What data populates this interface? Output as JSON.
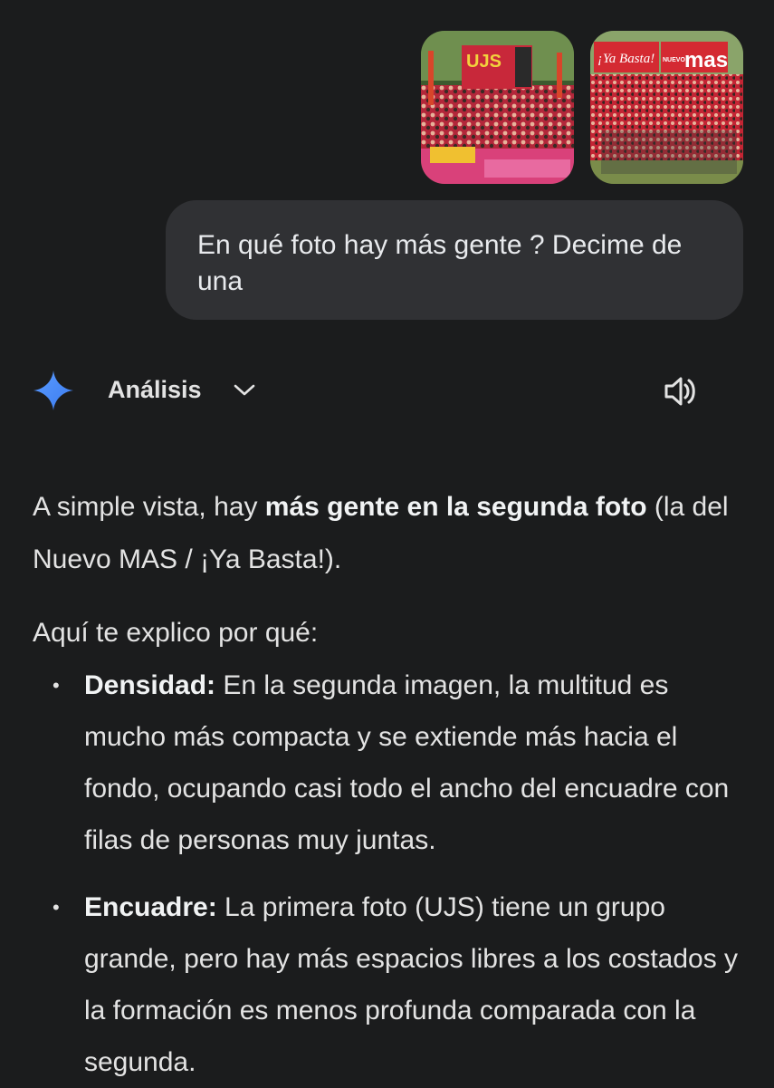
{
  "attachments": [
    {
      "banner_text": "UJS"
    },
    {
      "banner_text": "¡Ya Basta!",
      "banner_text_2": "NUEVO",
      "banner_text_3": "mas"
    }
  ],
  "user_message": {
    "text": "En qué foto hay más gente ? Decime de una"
  },
  "response": {
    "mode_label": "Análisis",
    "icons": {
      "logo": "gemini-sparkle-icon",
      "mode": "chevron-down-icon",
      "audio": "speaker-icon"
    },
    "intro_plain": "A simple vista, hay ",
    "intro_bold": "más gente en la segunda foto",
    "intro_rest": " (la del Nuevo MAS / ¡Ya Basta!).",
    "explain": "Aquí te explico por qué:",
    "points": [
      {
        "bullet": "•",
        "title": "Densidad:",
        "text": " En la segunda imagen, la multitud es mucho más compacta y se extiende más hacia el fondo, ocupando casi todo el ancho del encuadre con filas de personas muy juntas."
      },
      {
        "bullet": "•",
        "title": "Encuadre:",
        "text": " La primera foto (UJS) tiene un grupo grande, pero hay más espacios libres a los costados y la formación es menos profunda comparada con la segunda."
      }
    ]
  },
  "colors": {
    "background": "#1b1c1d",
    "bubble": "#303134",
    "accent_star": "#4a8ef7"
  }
}
